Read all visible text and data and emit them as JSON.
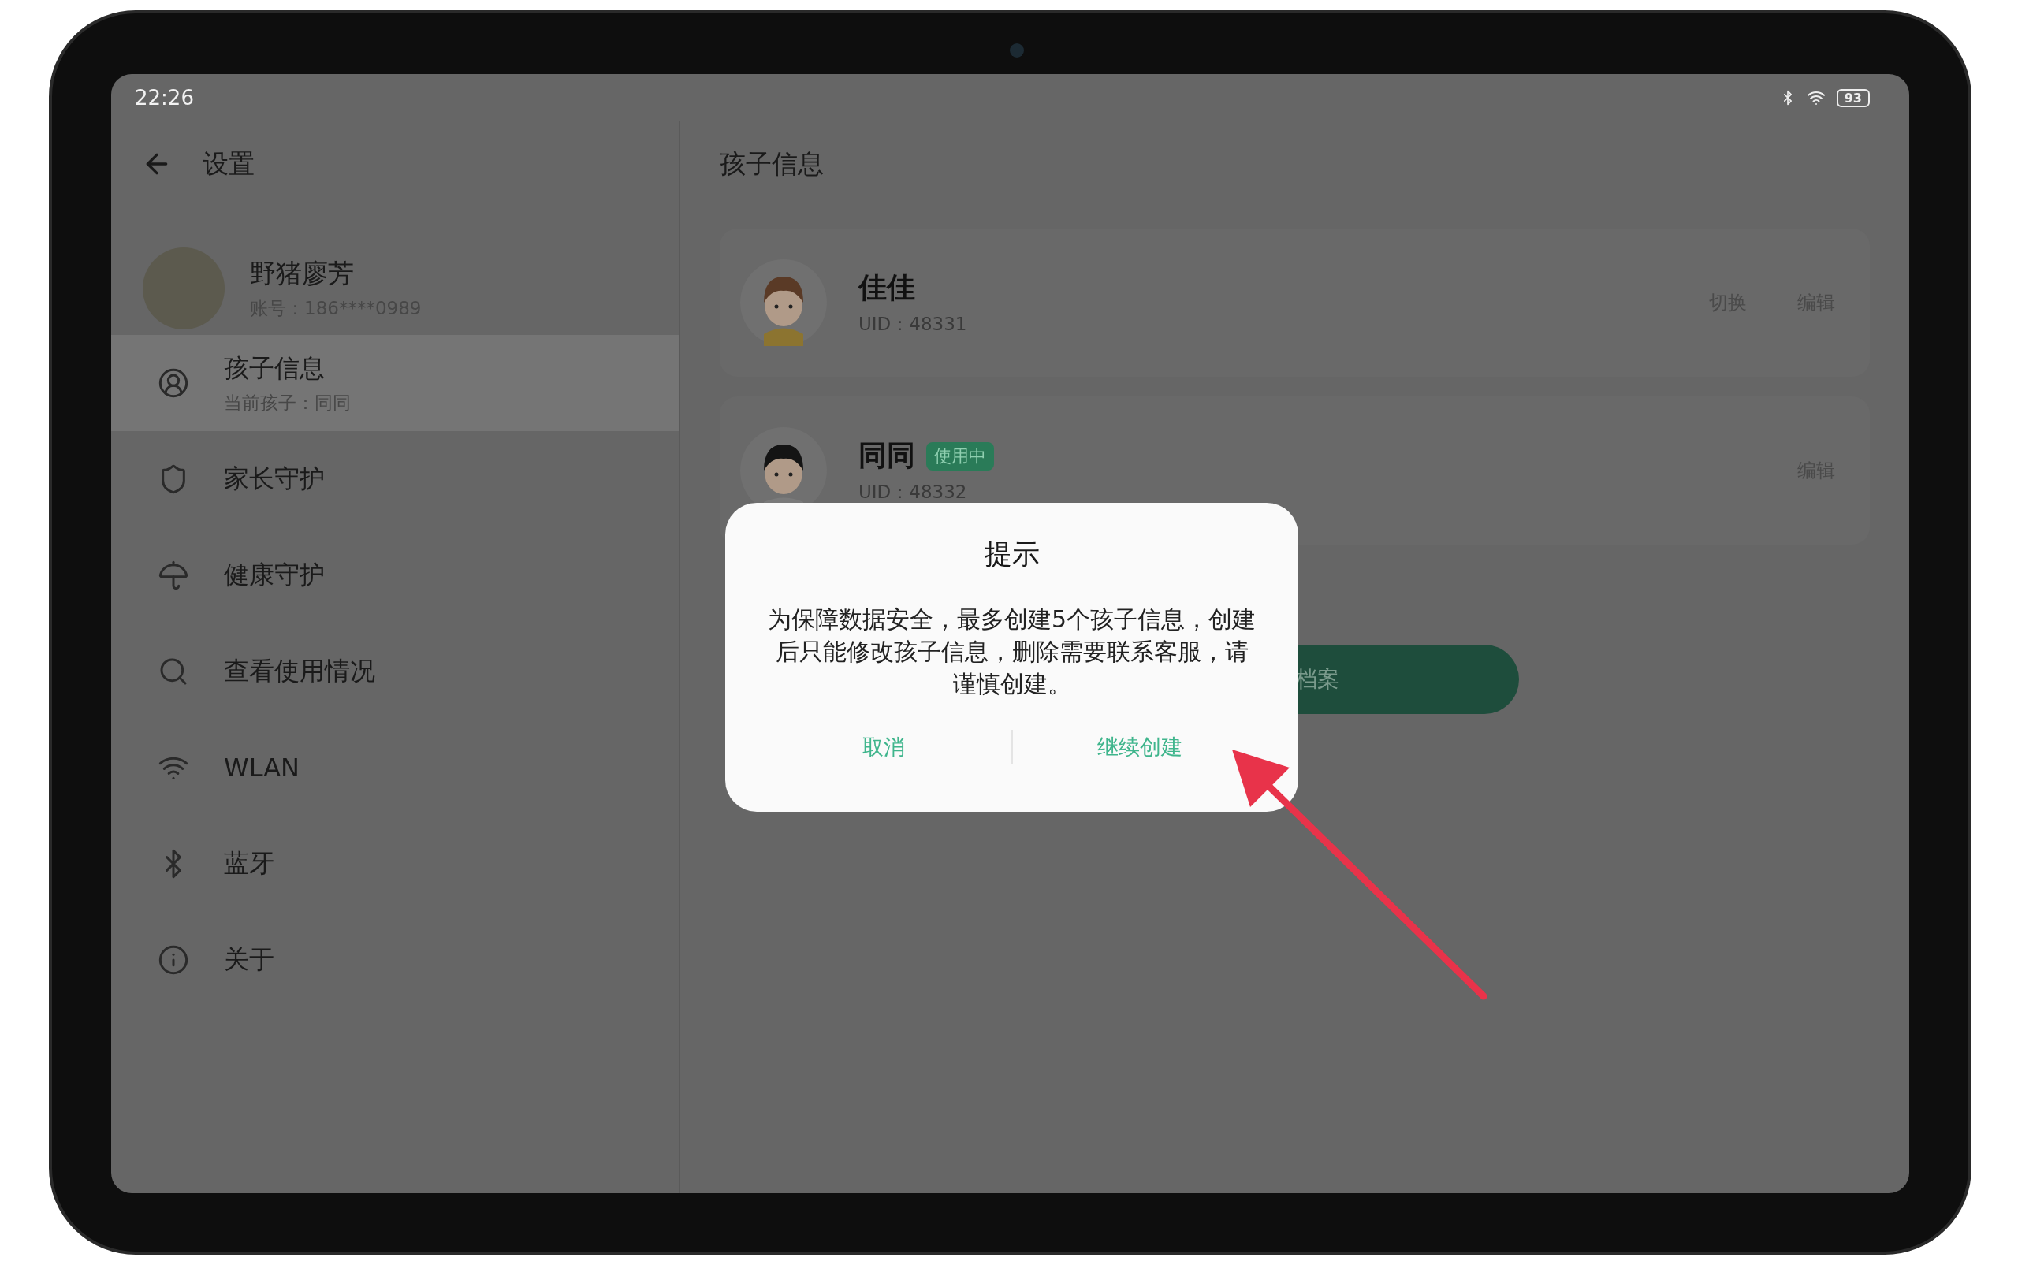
{
  "status_bar": {
    "time": "22:26",
    "battery": "93"
  },
  "sidebar": {
    "title": "设置",
    "profile": {
      "name": "野猪廖芳",
      "account": "账号：186****0989"
    },
    "items": [
      {
        "kind": "child",
        "label": "孩子信息",
        "subtitle": "当前孩子：同同",
        "selected": true
      },
      {
        "kind": "shield",
        "label": "家长守护",
        "selected": false
      },
      {
        "kind": "umbrella",
        "label": "健康守护",
        "selected": false
      },
      {
        "kind": "search",
        "label": "查看使用情况",
        "selected": false
      },
      {
        "kind": "wifi",
        "label": "WLAN",
        "selected": false
      },
      {
        "kind": "bluetooth",
        "label": "蓝牙",
        "selected": false
      },
      {
        "kind": "info",
        "label": "关于",
        "selected": false
      }
    ]
  },
  "content": {
    "title": "孩子信息",
    "profiles": [
      {
        "kind": "girl",
        "name": "佳佳",
        "uid": "UID：48331",
        "in_use": false,
        "actions": [
          "切换",
          "编辑"
        ]
      },
      {
        "kind": "boy",
        "name": "同同",
        "badge": "使用中",
        "uid": "UID：48332",
        "in_use": true,
        "actions": [
          "编辑"
        ]
      }
    ],
    "create_button": "档案"
  },
  "dialog": {
    "title": "提示",
    "message": "为保障数据安全，最多创建5个孩子信息，创建后只能修改孩子信息，删除需要联系客服，请谨慎创建。",
    "buttons": [
      {
        "label": "取消"
      },
      {
        "label": "继续创建"
      }
    ]
  }
}
